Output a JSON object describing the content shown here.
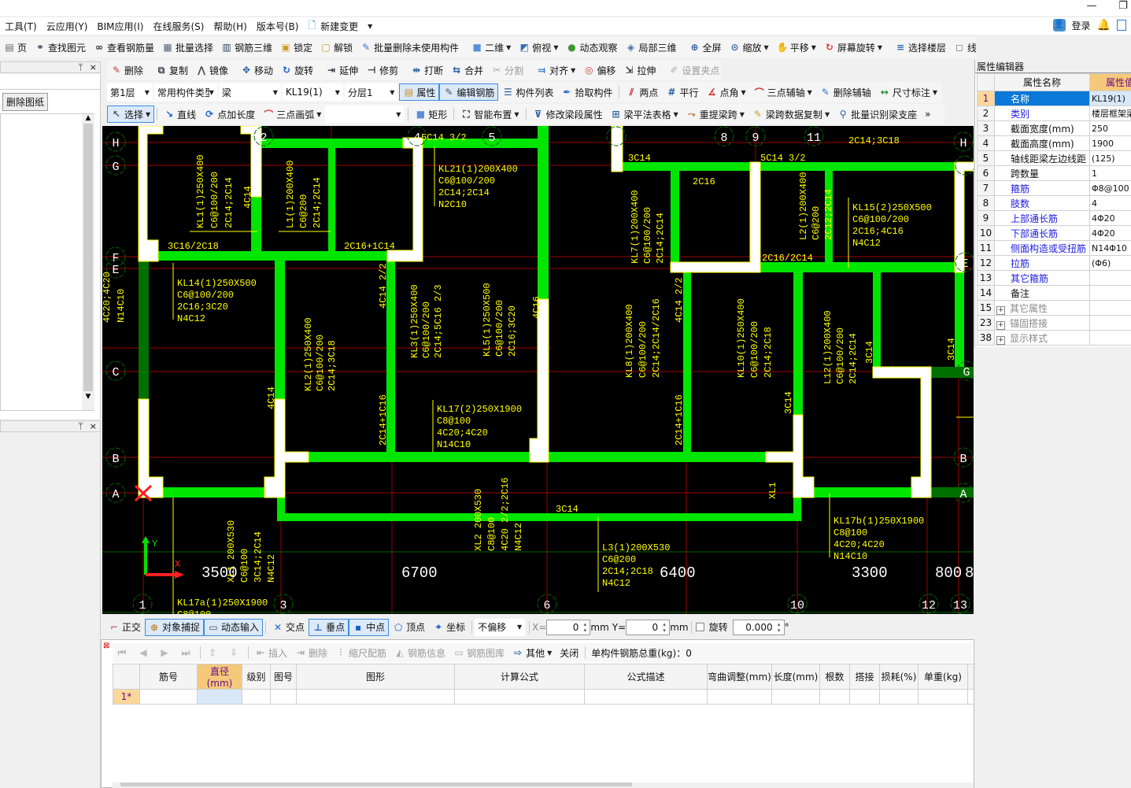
{
  "window": {
    "minimize_icon": "minimize-icon",
    "restore_icon": "restore-icon",
    "login": "登录"
  },
  "menu": [
    "工具(T)",
    "云应用(Y)",
    "BIM应用(I)",
    "在线服务(S)",
    "帮助(H)",
    "版本号(B)",
    "新建变更"
  ],
  "toolbar": {
    "row1": [
      {
        "label": "页",
        "icon": "page-icon"
      },
      {
        "label": "查找图元",
        "icon": "binoculars-icon"
      },
      {
        "label": "查看钢筋量",
        "icon": "glasses-icon"
      },
      {
        "label": "批量选择",
        "icon": "batch-select-icon"
      },
      {
        "label": "钢筋三维",
        "icon": "rebar-3d-icon"
      },
      {
        "label": "锁定",
        "icon": "lock-icon"
      },
      {
        "label": "解锁",
        "icon": "unlock-icon"
      },
      {
        "label": "批量删除未使用构件",
        "icon": "broom-icon"
      },
      {
        "sep": true
      },
      {
        "label": "二维",
        "icon": "2d-view-icon",
        "dropdown": true
      },
      {
        "label": "俯视",
        "icon": "top-view-icon",
        "dropdown": true
      },
      {
        "label": "动态观察",
        "icon": "orbit-icon"
      },
      {
        "label": "局部三维",
        "icon": "local-3d-icon"
      },
      {
        "sep": true
      },
      {
        "label": "全屏",
        "icon": "fullscreen-icon"
      },
      {
        "label": "缩放",
        "icon": "zoom-icon",
        "dropdown": true
      },
      {
        "label": "平移",
        "icon": "pan-hand-icon",
        "dropdown": true
      },
      {
        "label": "屏幕旋转",
        "icon": "screen-rotate-icon",
        "dropdown": true
      },
      {
        "sep": true
      },
      {
        "label": "选择楼层",
        "icon": "select-floor-icon"
      },
      {
        "label": "线框",
        "icon": "wireframe-icon"
      }
    ],
    "row2": [
      {
        "label": "删除",
        "icon": "delete-icon"
      },
      {
        "sep": true
      },
      {
        "label": "复制",
        "icon": "copy-icon"
      },
      {
        "label": "镜像",
        "icon": "mirror-icon"
      },
      {
        "sep": true
      },
      {
        "label": "移动",
        "icon": "move-icon"
      },
      {
        "label": "旋转",
        "icon": "rotate-icon"
      },
      {
        "sep": true
      },
      {
        "label": "延伸",
        "icon": "extend-icon"
      },
      {
        "label": "修剪",
        "icon": "trim-icon"
      },
      {
        "sep": true
      },
      {
        "label": "打断",
        "icon": "break-icon"
      },
      {
        "label": "合并",
        "icon": "merge-icon"
      },
      {
        "label": "分割",
        "icon": "split-icon",
        "disabled": true
      },
      {
        "sep": true
      },
      {
        "label": "对齐",
        "icon": "align-icon",
        "dropdown": true
      },
      {
        "label": "偏移",
        "icon": "offset-icon"
      },
      {
        "label": "拉伸",
        "icon": "stretch-icon"
      },
      {
        "sep": true
      },
      {
        "label": "设置夹点",
        "icon": "grip-icon",
        "disabled": true
      }
    ],
    "selectors": [
      {
        "value": "第1层"
      },
      {
        "value": "常用构件类型"
      },
      {
        "value": "梁"
      },
      {
        "value": "KL19(1)"
      },
      {
        "value": "分层1"
      }
    ],
    "row3": [
      {
        "label": "属性",
        "icon": "properties-icon",
        "active": true
      },
      {
        "label": "编辑钢筋",
        "icon": "edit-rebar-icon",
        "active": true
      },
      {
        "label": "构件列表",
        "icon": "component-list-icon"
      },
      {
        "label": "拾取构件",
        "icon": "eyedropper-icon"
      },
      {
        "sep": true
      },
      {
        "label": "两点",
        "icon": "two-point-axis-icon"
      },
      {
        "label": "平行",
        "icon": "parallel-axis-icon"
      },
      {
        "label": "点角",
        "icon": "point-angle-icon",
        "dropdown": true
      },
      {
        "label": "三点辅轴",
        "icon": "three-point-axis-icon",
        "dropdown": true
      },
      {
        "label": "删除辅轴",
        "icon": "delete-axis-icon"
      },
      {
        "label": "尺寸标注",
        "icon": "dimension-icon",
        "dropdown": true
      }
    ],
    "row4": [
      {
        "label": "选择",
        "icon": "cursor-icon",
        "dropdown": true,
        "active": true
      },
      {
        "sep": true
      },
      {
        "label": "直线",
        "icon": "line-icon"
      },
      {
        "label": "点加长度",
        "icon": "point-length-icon"
      },
      {
        "label": "三点画弧",
        "icon": "arc-icon",
        "dropdown": true
      },
      {
        "combo": true
      },
      {
        "sep": true
      },
      {
        "label": "矩形",
        "icon": "rectangle-icon"
      },
      {
        "sep": true
      },
      {
        "label": "智能布置",
        "icon": "smart-layout-icon",
        "dropdown": true
      },
      {
        "sep": true
      },
      {
        "label": "修改梁段属性",
        "icon": "modify-beam-icon"
      },
      {
        "label": "梁平法表格",
        "icon": "beam-table-icon",
        "dropdown": true
      },
      {
        "label": "重提梁跨",
        "icon": "re-span-icon",
        "dropdown": true
      },
      {
        "label": "梁跨数据复制",
        "icon": "span-copy-icon",
        "dropdown": true
      },
      {
        "label": "批量识别梁支座",
        "icon": "identify-support-icon"
      },
      {
        "label": "»",
        "icon": "more-icon"
      }
    ]
  },
  "left_panel": {
    "delete_drawing": "删除图纸",
    "pin": "ᛘ",
    "close": "×"
  },
  "drawing": {
    "axes_left": [
      "H",
      "G",
      "F",
      "E",
      "C",
      "B",
      "A"
    ],
    "axes_right": [
      "H",
      "G",
      "E",
      "G",
      "B",
      "A"
    ],
    "axes_top": [
      "2",
      "4",
      "5",
      "",
      "8",
      "9",
      "11"
    ],
    "axes_bottom": [
      "1",
      "3",
      "6",
      "10",
      "12",
      "13"
    ],
    "dims": [
      "3500",
      "6700",
      "6400",
      "3300",
      "800",
      "8"
    ],
    "coord": {
      "x": "X",
      "y": "Y"
    },
    "h": {
      "a1": "5C14 3/2",
      "a2": "3C16/2C18",
      "a3": "2C16+1C14",
      "a4": "3C14",
      "a5": "5C14 3/2",
      "a6": "2C14;3C18",
      "a7": "2C16",
      "a8": "2C16/2C14",
      "a9": "3C14",
      "kl21": [
        "KL21(1)200X400",
        "C6@100/200",
        "2C14;2C14",
        "N2C10"
      ],
      "kl14": [
        "KL14(1)250X500",
        "C6@100/200",
        "2C16;3C20",
        "N4C12"
      ],
      "kl17": [
        "KL17(2)250X1900",
        "C8@100",
        "4C20;4C20",
        "N14C10"
      ],
      "kl15": [
        "KL15(2)250X500",
        "C6@100/200",
        "2C16;4C16",
        "N4C12"
      ],
      "l3": [
        "L3(1)200X530",
        "C6@200",
        "2C14;2C18",
        "N4C12"
      ],
      "kl17b": [
        "KL17b(1)250X1900",
        "C8@100",
        "4C20;4C20",
        "N14C10"
      ],
      "kl17a": [
        "KL17a(1)250X1900",
        "C8@100"
      ]
    },
    "v": {
      "kl1": [
        "KL1(1)250X400",
        "C6@100/200",
        "2C14;2C14"
      ],
      "l1": [
        "L1(1)200X400",
        "C6@200",
        "2C14;2C14"
      ],
      "left": [
        "4C20;4C20",
        "N14C10"
      ],
      "kl3": [
        "KL3(1)250X400",
        "C6@100/200",
        "2C14;5C16 2/3"
      ],
      "kl5": [
        "KL5(1)250X500",
        "C6@100/200",
        "2C16;3C20"
      ],
      "kl2": [
        "KL2(1)250X400",
        "C6@100/200",
        "2C14;3C18"
      ],
      "xl1": [
        "XL1 200X530",
        "C6@100",
        "3C14;2C14",
        "N4C12"
      ],
      "xl2": [
        "XL2 200X530",
        "C8@100",
        "4C20 2/2;2C16",
        "N4C12"
      ],
      "kl7": [
        "KL7(1)200X400",
        "C6@100/200",
        "2C14;2C14"
      ],
      "l2": [
        "L2(1)200X400",
        "C6@200",
        "2C12;2C14"
      ],
      "kl8": [
        "KL8(1)200X400",
        "C6@100/200",
        "2C14;2C14/2C16"
      ],
      "kl10": [
        "KL10(1)250X400",
        "C6@100/200",
        "2C14;2C18"
      ],
      "l12": [
        "L12(1)200X400",
        "C6@100/200",
        "2C14;2C14"
      ],
      "s": [
        "4C14",
        "4C14 2/2",
        "4C16",
        "4C14",
        "2C14+1C16",
        "4C14 2/2",
        "3C14",
        "3C14",
        "2C14+1C16",
        "3C14",
        "XL1"
      ]
    }
  },
  "snapbar": {
    "items": [
      {
        "label": "正交",
        "icon": "ortho-icon"
      },
      {
        "label": "对象捕捉",
        "icon": "object-snap-icon",
        "active": true
      },
      {
        "label": "动态输入",
        "icon": "dynamic-input-icon",
        "active": true
      },
      {
        "sep": true
      },
      {
        "label": "交点",
        "icon": "intersection-icon"
      },
      {
        "label": "垂点",
        "icon": "perpendicular-icon",
        "active": true
      },
      {
        "label": "中点",
        "icon": "midpoint-icon",
        "active": true
      },
      {
        "label": "顶点",
        "icon": "vertex-icon"
      },
      {
        "label": "坐标",
        "icon": "coordinate-icon"
      }
    ],
    "offset_mode": "不偏移",
    "x_label": "X=",
    "x_value": "0",
    "y_label": "Y=",
    "y_value": "0",
    "unit": "mm",
    "rotate_label": "旋转",
    "rotate_value": "0.000",
    "degree": "°",
    "rotate_checked": false
  },
  "rebar": {
    "toolbar": [
      {
        "label": "",
        "icon": "first-icon",
        "disabled": true
      },
      {
        "label": "",
        "icon": "prev-icon",
        "disabled": true
      },
      {
        "label": "",
        "icon": "next-icon",
        "disabled": true
      },
      {
        "label": "",
        "icon": "last-icon",
        "disabled": true
      },
      {
        "sep": true
      },
      {
        "label": "",
        "icon": "move-up-icon",
        "disabled": true
      },
      {
        "label": "",
        "icon": "move-down-icon",
        "disabled": true
      },
      {
        "sep": true
      },
      {
        "label": "插入",
        "icon": "insert-icon",
        "disabled": true
      },
      {
        "label": "删除",
        "icon": "delete-row-icon",
        "disabled": true
      },
      {
        "label": "缩尺配筋",
        "icon": "scale-rebar-icon",
        "disabled": true
      },
      {
        "label": "钢筋信息",
        "icon": "rebar-info-icon",
        "disabled": true
      },
      {
        "label": "钢筋图库",
        "icon": "rebar-library-icon",
        "disabled": true
      },
      {
        "label": "其他",
        "icon": "other-icon",
        "dropdown": true
      },
      {
        "label": "关闭",
        "icon": "close-panel-icon"
      }
    ],
    "total_label": "单构件钢筋总重(kg)：0",
    "columns": [
      "",
      "筋号",
      "直径(mm)",
      "级别",
      "图号",
      "图形",
      "计算公式",
      "公式描述",
      "弯曲调整(mm)",
      "长度(mm)",
      "根数",
      "搭接",
      "损耗(%)",
      "单重(kg)",
      ""
    ],
    "rows": [
      [
        "1*",
        "",
        "",
        "",
        "",
        "",
        "",
        "",
        "",
        "",
        "",
        "",
        "",
        "",
        ""
      ]
    ]
  },
  "properties": {
    "title": "属性编辑器",
    "col_name": "属性名称",
    "col_value": "属性值",
    "rows": [
      {
        "n": "1",
        "name": "名称",
        "value": "KL19(1)",
        "link": true,
        "selected": true
      },
      {
        "n": "2",
        "name": "类别",
        "value": "楼层框架梁",
        "link": true
      },
      {
        "n": "3",
        "name": "截面宽度(mm)",
        "value": "250"
      },
      {
        "n": "4",
        "name": "截面高度(mm)",
        "value": "1900"
      },
      {
        "n": "5",
        "name": "轴线距梁左边线距",
        "value": "(125)"
      },
      {
        "n": "6",
        "name": "跨数量",
        "value": "1"
      },
      {
        "n": "7",
        "name": "箍筋",
        "value": "Φ8@100",
        "link": true
      },
      {
        "n": "8",
        "name": "肢数",
        "value": "4",
        "link": true
      },
      {
        "n": "9",
        "name": "上部通长筋",
        "value": "4Φ20",
        "link": true
      },
      {
        "n": "10",
        "name": "下部通长筋",
        "value": "4Φ20",
        "link": true
      },
      {
        "n": "11",
        "name": "侧面构造或受扭筋",
        "value": "N14Φ10",
        "link": true
      },
      {
        "n": "12",
        "name": "拉筋",
        "value": "(Φ6)",
        "link": true
      },
      {
        "n": "13",
        "name": "其它箍筋",
        "value": "",
        "link": true
      },
      {
        "n": "14",
        "name": "备注",
        "value": ""
      },
      {
        "n": "15",
        "name": "其它属性",
        "value": "",
        "group": true
      },
      {
        "n": "23",
        "name": "锚固搭接",
        "value": "",
        "group": true
      },
      {
        "n": "38",
        "name": "显示样式",
        "value": "",
        "group": true
      }
    ]
  },
  "colors": {
    "beam": "#00e600",
    "column": "#ffffff",
    "annotation": "#ffff00",
    "axis": "#a00000",
    "canvas": "#000000",
    "active": "#3c8ee0",
    "selected_row": "#0a78d7"
  }
}
